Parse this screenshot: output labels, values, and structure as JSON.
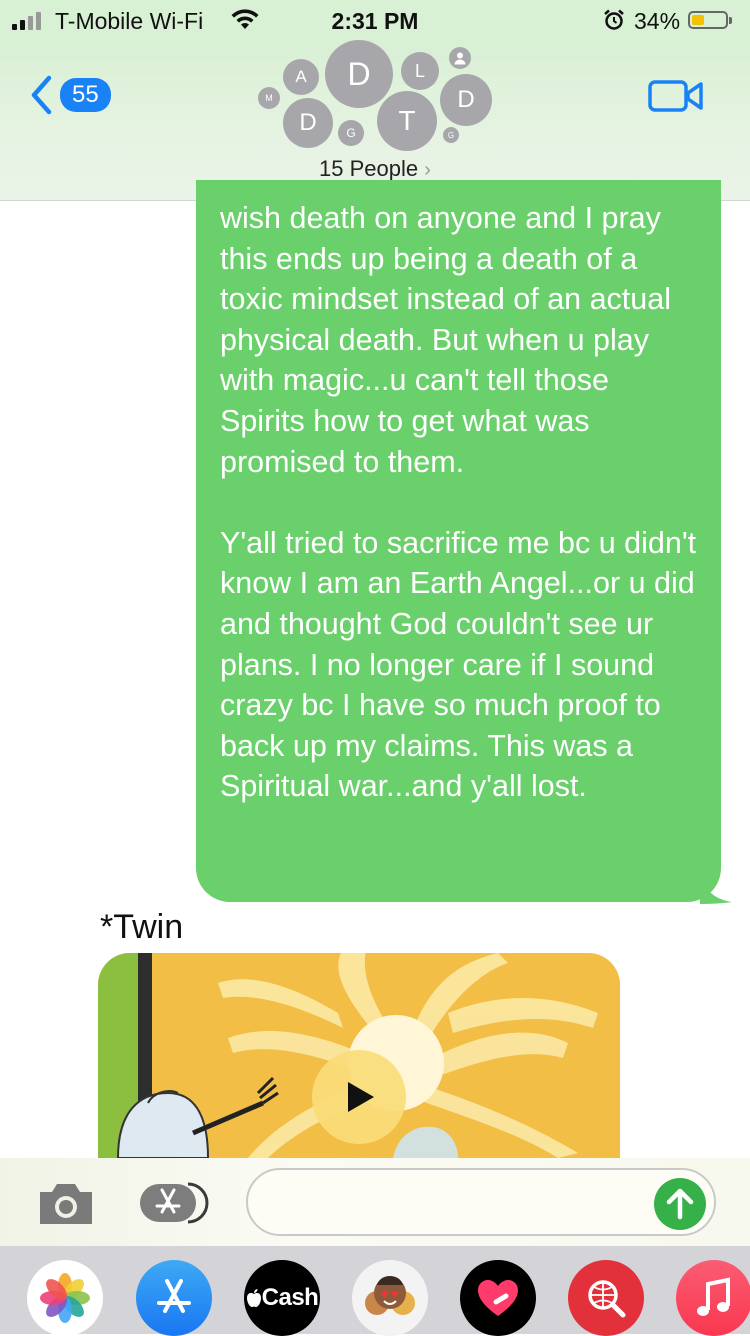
{
  "status_bar": {
    "carrier": "T-Mobile Wi-Fi",
    "time": "2:31 PM",
    "battery_percent": "34%",
    "battery_level": 0.34,
    "signal_bars": 2,
    "icons": [
      "signal-icon",
      "wifi-icon",
      "alarm-icon",
      "battery-icon"
    ]
  },
  "header": {
    "back_count": "55",
    "people_label": "15 People",
    "avatars": [
      {
        "initial": "A"
      },
      {
        "initial": "D"
      },
      {
        "initial": "L"
      },
      {
        "initial": ""
      },
      {
        "initial": "M"
      },
      {
        "initial": "D"
      },
      {
        "initial": "G"
      },
      {
        "initial": "T"
      },
      {
        "initial": "D"
      },
      {
        "initial": "G"
      }
    ]
  },
  "messages": [
    {
      "from": "me",
      "paragraphs": [
        "wish death on anyone and I pray this ends up being a death of a toxic mindset instead of an actual physical death. But when u play with magic...u can't tell those Spirits how to get what was promised to them.",
        "Y'all tried to sacrifice me bc u didn't know I am an Earth Angel...or u did and thought God couldn't see ur plans. I no longer care if I sound crazy bc I have so much proof to back up my claims. This was a Spiritual war...and y'all lost."
      ]
    },
    {
      "from": "me",
      "text": "*Twin"
    }
  ],
  "video_attachment": {
    "type": "video",
    "play_icon": "play-icon"
  },
  "input_bar": {
    "placeholder": "",
    "icons": [
      "camera-icon",
      "app-store-icon",
      "send-arrow-icon"
    ]
  },
  "app_drawer": {
    "apps": [
      {
        "name": "photos-app",
        "label": ""
      },
      {
        "name": "app-store-app",
        "label": ""
      },
      {
        "name": "cash-app",
        "label": "Cash"
      },
      {
        "name": "memoji-stickers-app",
        "label": ""
      },
      {
        "name": "digital-touch-app",
        "label": ""
      },
      {
        "name": "web-search-app",
        "label": ""
      },
      {
        "name": "music-app",
        "label": ""
      }
    ]
  },
  "colors": {
    "sent_bubble": "#6ad06b",
    "accent_blue": "#1a82f7",
    "send_button": "#36b14a",
    "avatar_gray": "#a7a7ab"
  }
}
